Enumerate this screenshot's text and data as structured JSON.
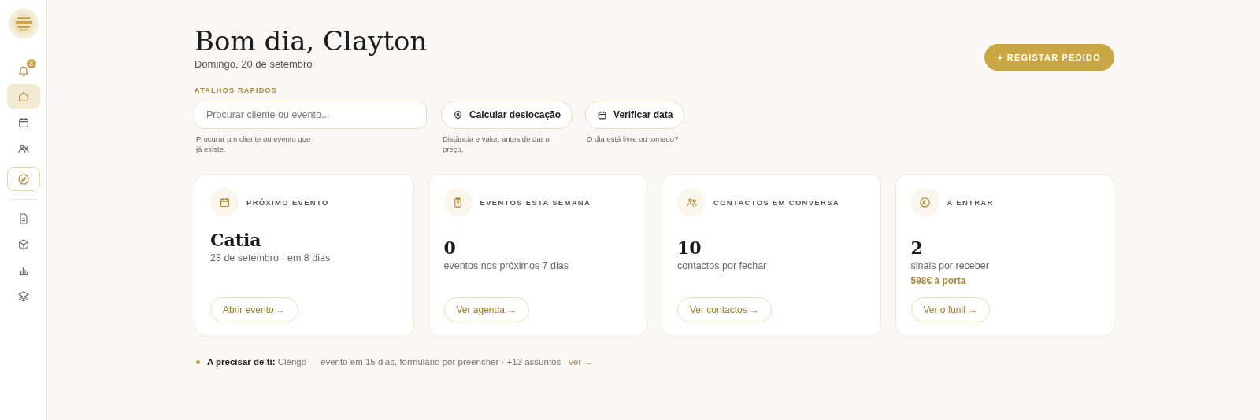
{
  "sidebar": {
    "notifications": {
      "badge": "3"
    },
    "items": [
      {
        "kind": "nav",
        "selected": true
      },
      {
        "kind": "nav",
        "selected": false
      },
      {
        "kind": "nav",
        "selected": false
      },
      {
        "kind": "featured",
        "selected": false
      },
      {
        "kind": "nav",
        "selected": false
      },
      {
        "kind": "nav",
        "selected": false
      },
      {
        "kind": "nav",
        "selected": false
      },
      {
        "kind": "nav",
        "selected": false
      }
    ]
  },
  "header": {
    "title": "Bom dia, Clayton",
    "date": "Domingo, 20 de setembro",
    "action": "+ REGISTAR PEDIDO"
  },
  "shortcuts": {
    "heading": "ATALHOS RÁPIDOS",
    "search": {
      "placeholder": "Procurar cliente ou evento...",
      "hint": "Procurar um cliente ou evento que já existe."
    },
    "buttons": [
      {
        "label": "Calcular deslocação",
        "hint": "Distância e valor, antes de dar o preço."
      },
      {
        "label": "Verificar data",
        "hint": "O dia está livre ou tomado?"
      }
    ]
  },
  "cards": [
    {
      "label": "PRÓXIMO EVENTO",
      "value": "Catia",
      "kind": "name",
      "subtitle": "28 de setembro · em 8 dias",
      "link": "Abrir evento →"
    },
    {
      "label": "EVENTOS ESTA SEMANA",
      "value": "0",
      "kind": "number",
      "subtitle": "eventos nos próximos 7 dias",
      "link": "Ver agenda →"
    },
    {
      "label": "CONTACTOS EM CONVERSA",
      "value": "10",
      "kind": "number",
      "subtitle": "contactos por fechar",
      "link": "Ver contactos →"
    },
    {
      "label": "A ENTRAR",
      "value": "2",
      "kind": "number",
      "subtitle": "sinais por receber",
      "highlight": "598€ à porta",
      "link": "Ver o funil →"
    }
  ],
  "attention": {
    "text": "**A precisar de ti:** Clérigo — evento em 15 dias, formulário por preencher · +13 assuntos",
    "link": "ver →"
  }
}
